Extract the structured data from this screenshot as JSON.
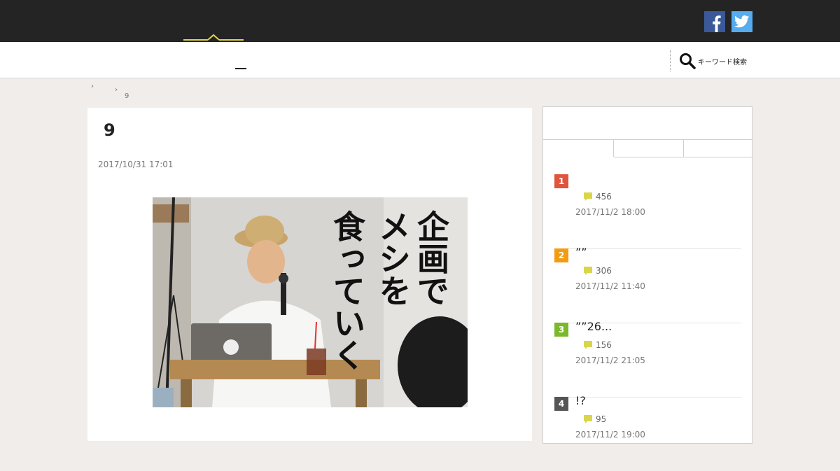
{
  "header": {
    "social": [
      {
        "name": "facebook-icon",
        "glyph": "f",
        "color": "#3b5998"
      },
      {
        "name": "twitter-icon",
        "glyph": "bird",
        "color": "#55acee"
      }
    ],
    "accent": "#e3d23a"
  },
  "nav": {
    "search_label": "キーワード検索",
    "search_icon": "search-icon"
  },
  "breadcrumb": {
    "separator": "›",
    "current": "9"
  },
  "article": {
    "title": "9",
    "date": "2017/10/31 17:01",
    "hero_caption_lines": [
      "企画で",
      "メシを",
      "食っていく"
    ]
  },
  "sidebar": {
    "ranking": [
      {
        "rank": "1",
        "title": "",
        "comments": "456",
        "time": "2017/11/2 18:00",
        "color": "#e0533d"
      },
      {
        "rank": "2",
        "title": "””",
        "comments": "306",
        "time": "2017/11/2 11:40",
        "color": "#f39c12"
      },
      {
        "rank": "3",
        "title": "””26...",
        "comments": "156",
        "time": "2017/11/2 21:05",
        "color": "#7bb82b"
      },
      {
        "rank": "4",
        "title": "!?",
        "comments": "95",
        "time": "2017/11/2 19:00",
        "color": "#555555"
      }
    ],
    "comment_icon": "comment-icon",
    "comment_color": "#d9d64a"
  }
}
